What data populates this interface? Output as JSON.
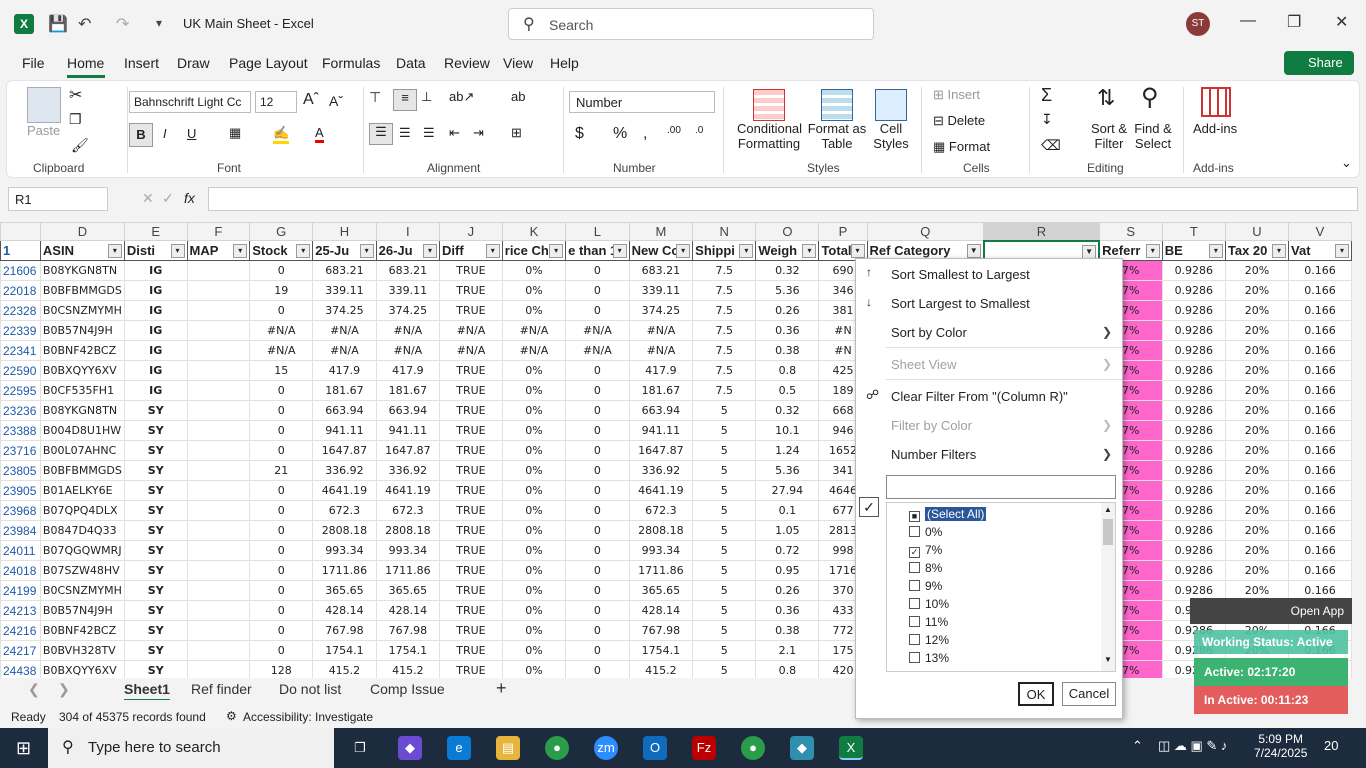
{
  "titlebar": {
    "app_icon": "X",
    "title": "UK Main Sheet  -  Excel",
    "search_placeholder": "Search",
    "avatar": "ST"
  },
  "menu": {
    "items": [
      "File",
      "Home",
      "Insert",
      "Draw",
      "Page Layout",
      "Formulas",
      "Data",
      "Review",
      "View",
      "Help"
    ],
    "share": "Share"
  },
  "ribbon": {
    "clipboard": {
      "label": "Clipboard",
      "paste": "Paste"
    },
    "font": {
      "label": "Font",
      "family": "Bahnschrift Light Cc",
      "size": "12"
    },
    "alignment": {
      "label": "Alignment"
    },
    "number": {
      "label": "Number",
      "format": "Number"
    },
    "styles": {
      "label": "Styles",
      "conditional": "Conditional",
      "formatting": "Formatting",
      "format_as": "Format as",
      "table": "Table",
      "cell": "Cell",
      "cell_styles": "Styles"
    },
    "cells": {
      "label": "Cells",
      "insert": "Insert",
      "delete": "Delete",
      "format": "Format"
    },
    "editing": {
      "label": "Editing",
      "sort": "Sort &",
      "filter": "Filter",
      "find": "Find &",
      "select": "Select"
    },
    "addins": {
      "label": "Add-ins",
      "btn": "Add-ins"
    }
  },
  "formula": {
    "namebox": "R1",
    "fx": "fx"
  },
  "grid": {
    "col_letters": [
      "D",
      "E",
      "F",
      "G",
      "H",
      "I",
      "J",
      "K",
      "L",
      "M",
      "N",
      "O",
      "P",
      "Q",
      "R",
      "S",
      "T",
      "U",
      "V"
    ],
    "headers": [
      "ASIN",
      "Disti",
      "MAP",
      "Stock",
      "25-Ju",
      "26-Ju",
      "Diff",
      "rice Ch",
      "e than 1",
      "New Co",
      "Shippi",
      "Weigh",
      "Total C",
      "Ref Category",
      "",
      "Referr",
      "BE",
      "Tax 20",
      "Vat"
    ],
    "rows": [
      [
        "21606",
        "B08YKGN8TN",
        "IG",
        "",
        "0",
        "683.21",
        "683.21",
        "TRUE",
        "0%",
        "0",
        "683.21",
        "7.5",
        "0.32",
        "690",
        "",
        "",
        "7%",
        "0.9286",
        "20%",
        "0.166"
      ],
      [
        "22018",
        "B0BFBMMGDS",
        "IG",
        "",
        "19",
        "339.11",
        "339.11",
        "TRUE",
        "0%",
        "0",
        "339.11",
        "7.5",
        "5.36",
        "346",
        "",
        "",
        "7%",
        "0.9286",
        "20%",
        "0.166"
      ],
      [
        "22328",
        "B0CSNZMYMH",
        "IG",
        "",
        "0",
        "374.25",
        "374.25",
        "TRUE",
        "0%",
        "0",
        "374.25",
        "7.5",
        "0.26",
        "381",
        "",
        "",
        "7%",
        "0.9286",
        "20%",
        "0.166"
      ],
      [
        "22339",
        "B0B57N4J9H",
        "IG",
        "",
        "#N/A",
        "#N/A",
        "#N/A",
        "#N/A",
        "#N/A",
        "#N/A",
        "#N/A",
        "7.5",
        "0.36",
        "#N",
        "",
        "",
        "7%",
        "0.9286",
        "20%",
        "0.166"
      ],
      [
        "22341",
        "B0BNF42BCZ",
        "IG",
        "",
        "#N/A",
        "#N/A",
        "#N/A",
        "#N/A",
        "#N/A",
        "#N/A",
        "#N/A",
        "7.5",
        "0.38",
        "#N",
        "",
        "",
        "7%",
        "0.9286",
        "20%",
        "0.166"
      ],
      [
        "22590",
        "B0BXQYY6XV",
        "IG",
        "",
        "15",
        "417.9",
        "417.9",
        "TRUE",
        "0%",
        "0",
        "417.9",
        "7.5",
        "0.8",
        "425",
        "",
        "",
        "7%",
        "0.9286",
        "20%",
        "0.166"
      ],
      [
        "22595",
        "B0CF535FH1",
        "IG",
        "",
        "0",
        "181.67",
        "181.67",
        "TRUE",
        "0%",
        "0",
        "181.67",
        "7.5",
        "0.5",
        "189",
        "",
        "",
        "7%",
        "0.9286",
        "20%",
        "0.166"
      ],
      [
        "23236",
        "B08YKGN8TN",
        "SY",
        "",
        "0",
        "663.94",
        "663.94",
        "TRUE",
        "0%",
        "0",
        "663.94",
        "5",
        "0.32",
        "668",
        "",
        "",
        "7%",
        "0.9286",
        "20%",
        "0.166"
      ],
      [
        "23388",
        "B004D8U1HW",
        "SY",
        "",
        "0",
        "941.11",
        "941.11",
        "TRUE",
        "0%",
        "0",
        "941.11",
        "5",
        "10.1",
        "946",
        "",
        "",
        "7%",
        "0.9286",
        "20%",
        "0.166"
      ],
      [
        "23716",
        "B00L07AHNC",
        "SY",
        "",
        "0",
        "1647.87",
        "1647.87",
        "TRUE",
        "0%",
        "0",
        "1647.87",
        "5",
        "1.24",
        "1652",
        "",
        "",
        "7%",
        "0.9286",
        "20%",
        "0.166"
      ],
      [
        "23805",
        "B0BFBMMGDS",
        "SY",
        "",
        "21",
        "336.92",
        "336.92",
        "TRUE",
        "0%",
        "0",
        "336.92",
        "5",
        "5.36",
        "341",
        "",
        "",
        "7%",
        "0.9286",
        "20%",
        "0.166"
      ],
      [
        "23905",
        "B01AELKY6E",
        "SY",
        "",
        "0",
        "4641.19",
        "4641.19",
        "TRUE",
        "0%",
        "0",
        "4641.19",
        "5",
        "27.94",
        "4646",
        "",
        "",
        "7%",
        "0.9286",
        "20%",
        "0.166"
      ],
      [
        "23968",
        "B07QPQ4DLX",
        "SY",
        "",
        "0",
        "672.3",
        "672.3",
        "TRUE",
        "0%",
        "0",
        "672.3",
        "5",
        "0.1",
        "677",
        "",
        "",
        "7%",
        "0.9286",
        "20%",
        "0.166"
      ],
      [
        "23984",
        "B0847D4Q33",
        "SY",
        "",
        "0",
        "2808.18",
        "2808.18",
        "TRUE",
        "0%",
        "0",
        "2808.18",
        "5",
        "1.05",
        "2813",
        "",
        "",
        "7%",
        "0.9286",
        "20%",
        "0.166"
      ],
      [
        "24011",
        "B07QGQWMRJ",
        "SY",
        "",
        "0",
        "993.34",
        "993.34",
        "TRUE",
        "0%",
        "0",
        "993.34",
        "5",
        "0.72",
        "998",
        "",
        "",
        "7%",
        "0.9286",
        "20%",
        "0.166"
      ],
      [
        "24018",
        "B07SZW48HV",
        "SY",
        "",
        "0",
        "1711.86",
        "1711.86",
        "TRUE",
        "0%",
        "0",
        "1711.86",
        "5",
        "0.95",
        "1716",
        "",
        "",
        "7%",
        "0.9286",
        "20%",
        "0.166"
      ],
      [
        "24199",
        "B0CSNZMYMH",
        "SY",
        "",
        "0",
        "365.65",
        "365.65",
        "TRUE",
        "0%",
        "0",
        "365.65",
        "5",
        "0.26",
        "370",
        "",
        "",
        "7%",
        "0.9286",
        "20%",
        "0.166"
      ],
      [
        "24213",
        "B0B57N4J9H",
        "SY",
        "",
        "0",
        "428.14",
        "428.14",
        "TRUE",
        "0%",
        "0",
        "428.14",
        "5",
        "0.36",
        "433",
        "",
        "",
        "7%",
        "0.9286",
        "20%",
        "0.166"
      ],
      [
        "24216",
        "B0BNF42BCZ",
        "SY",
        "",
        "0",
        "767.98",
        "767.98",
        "TRUE",
        "0%",
        "0",
        "767.98",
        "5",
        "0.38",
        "772",
        "",
        "",
        "7%",
        "0.9286",
        "20%",
        "0.166"
      ],
      [
        "24217",
        "B0BVH328TV",
        "SY",
        "",
        "0",
        "1754.1",
        "1754.1",
        "TRUE",
        "0%",
        "0",
        "1754.1",
        "5",
        "2.1",
        "175",
        "",
        "",
        "7%",
        "0.9286",
        "20%",
        "0.166"
      ],
      [
        "24438",
        "B0BXQYY6XV",
        "SY",
        "",
        "128",
        "415.2",
        "415.2",
        "TRUE",
        "0%",
        "0",
        "415.2",
        "5",
        "0.8",
        "420",
        "",
        "",
        "7%",
        "0.9286",
        "20%",
        "0.166"
      ]
    ]
  },
  "sheets": {
    "tabs": [
      "Sheet1",
      "Ref finder",
      "Do not list",
      "Comp Issue"
    ],
    "add": "+"
  },
  "status": {
    "ready": "Ready",
    "records": "304 of 45375 records found",
    "accessibility": "Accessibility: Investigate"
  },
  "filter_menu": {
    "sort_asc": "Sort Smallest to Largest",
    "sort_desc": "Sort Largest to Smallest",
    "sort_color": "Sort by Color",
    "sheet_view": "Sheet View",
    "clear": "Clear Filter From \"(Column R)\"",
    "filter_color": "Filter by Color",
    "number_filters": "Number Filters",
    "items": [
      {
        "label": "(Select All)",
        "state": "partial"
      },
      {
        "label": "0%",
        "state": "off"
      },
      {
        "label": "7%",
        "state": "on"
      },
      {
        "label": "8%",
        "state": "off"
      },
      {
        "label": "9%",
        "state": "off"
      },
      {
        "label": "10%",
        "state": "off"
      },
      {
        "label": "11%",
        "state": "off"
      },
      {
        "label": "12%",
        "state": "off"
      },
      {
        "label": "13%",
        "state": "off"
      }
    ],
    "ok": "OK",
    "cancel": "Cancel"
  },
  "work_status": {
    "open": "Open App",
    "title": "Working Status: Active",
    "active": "Active: 02:17:20",
    "inactive": "In Active: 00:11:23"
  },
  "taskbar": {
    "search": "Type here to search",
    "time": "5:09 PM",
    "date": "7/24/2025",
    "notif": "20"
  },
  "colors": {
    "excel_green": "#107c41",
    "pink": "#ff66cc",
    "active_green": "#3cb371",
    "inactive_red": "#e35d5d"
  }
}
